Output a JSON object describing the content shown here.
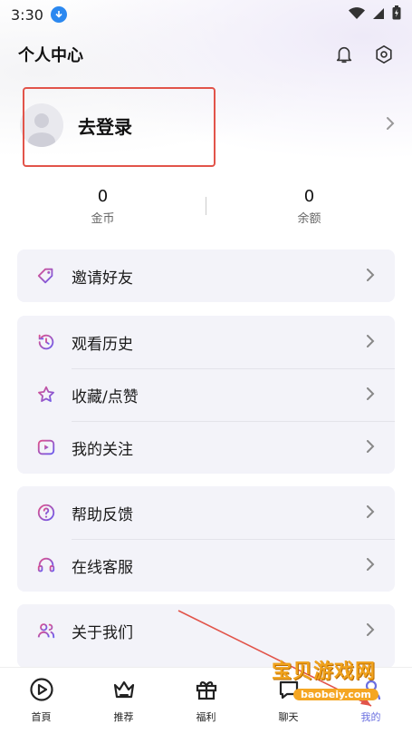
{
  "status": {
    "time": "3:30"
  },
  "header": {
    "title": "个人中心",
    "icons": [
      "bell-icon",
      "settings-hexagon-icon"
    ]
  },
  "profile": {
    "login_label": "去登录"
  },
  "stats": [
    {
      "value": "0",
      "label": "金币"
    },
    {
      "value": "0",
      "label": "余额"
    }
  ],
  "menu": {
    "group1": [
      {
        "label": "邀请好友",
        "icon": "tag-icon"
      }
    ],
    "group2": [
      {
        "label": "观看历史",
        "icon": "history-icon"
      },
      {
        "label": "收藏/点赞",
        "icon": "star-icon"
      },
      {
        "label": "我的关注",
        "icon": "play-square-icon"
      }
    ],
    "group3": [
      {
        "label": "帮助反馈",
        "icon": "help-circle-icon"
      },
      {
        "label": "在线客服",
        "icon": "headset-icon"
      }
    ],
    "group4": [
      {
        "label": "关于我们",
        "icon": "users-icon"
      }
    ]
  },
  "tabbar": {
    "tabs": [
      {
        "label": "首頁",
        "icon": "play-circle-icon"
      },
      {
        "label": "推荐",
        "icon": "crown-icon"
      },
      {
        "label": "福利",
        "icon": "gift-icon"
      },
      {
        "label": "聊天",
        "icon": "chat-icon"
      },
      {
        "label": "我的",
        "icon": "user-icon"
      }
    ],
    "active_index": 4
  },
  "watermark": {
    "text": "宝贝游戏网",
    "url": "baobeiy.com"
  },
  "colors": {
    "accent": "#6a6fe0",
    "icon_gradient_start": "#e0508a",
    "icon_gradient_end": "#6a5cf0",
    "annotation_red": "#e2544a"
  }
}
